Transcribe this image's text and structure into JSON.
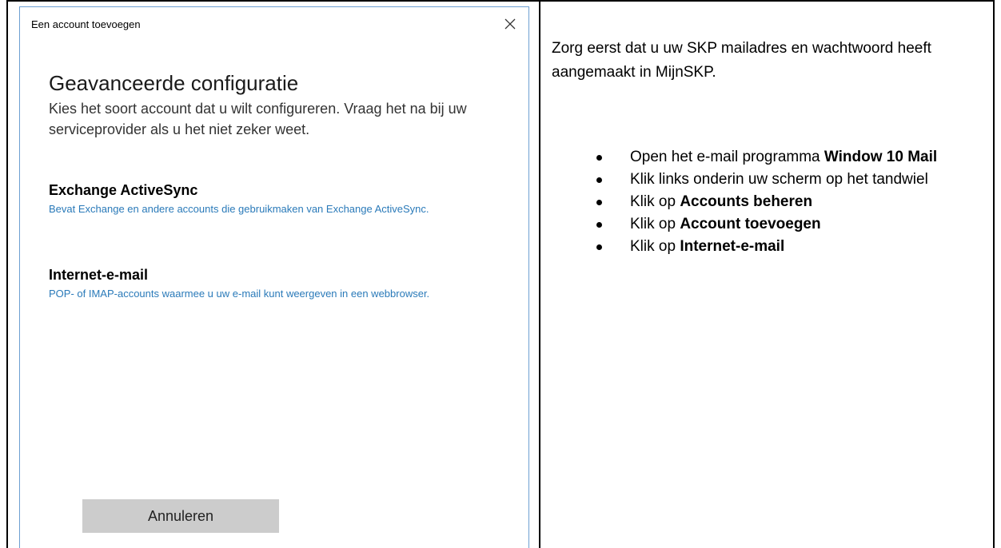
{
  "dialog": {
    "title": "Een account toevoegen",
    "close_icon": "close-icon",
    "heading": "Geavanceerde configuratie",
    "description": "Kies het soort account dat u wilt configureren. Vraag het na bij uw serviceprovider als u het niet zeker weet.",
    "options": [
      {
        "title": "Exchange ActiveSync",
        "description": "Bevat Exchange en andere accounts die gebruikmaken van Exchange ActiveSync."
      },
      {
        "title": "Internet-e-mail",
        "description": "POP- of IMAP-accounts waarmee u uw e-mail kunt weergeven in een webbrowser."
      }
    ],
    "cancel_label": "Annuleren",
    "colors": {
      "link": "#2a7ab9",
      "border": "#6c9fd2",
      "button": "#cccccc"
    }
  },
  "instructions": {
    "intro": "Zorg eerst dat u uw SKP mailadres en wachtwoord heeft aangemaakt in MijnSKP.",
    "steps": [
      {
        "text": "Open het e-mail programma ",
        "bold": "Window 10 Mail"
      },
      {
        "text": "Klik links onderin uw scherm op het tandwiel",
        "bold": ""
      },
      {
        "text": "Klik op  ",
        "bold": "Accounts beheren"
      },
      {
        "text": "Klik op ",
        "bold": "Account toevoegen"
      },
      {
        "text": "Klik op ",
        "bold": "Internet-e-mail"
      }
    ]
  }
}
